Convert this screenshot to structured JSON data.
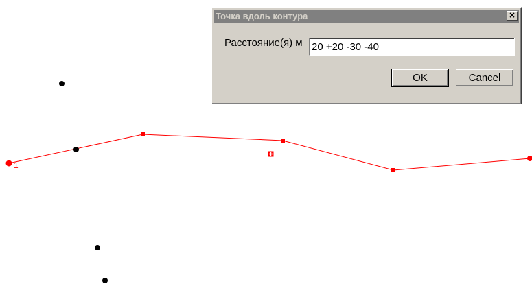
{
  "dialog": {
    "title": "Точка вдоль контура",
    "close_glyph": "×",
    "distance_label": "Расстояние(я) м",
    "distance_value": "20 +20 -30 -40",
    "ok_label": "OK",
    "cancel_label": "Cancel"
  },
  "canvas": {
    "start_marker_label": "1",
    "contour_color": "#ff0000",
    "point_color": "#000000"
  }
}
